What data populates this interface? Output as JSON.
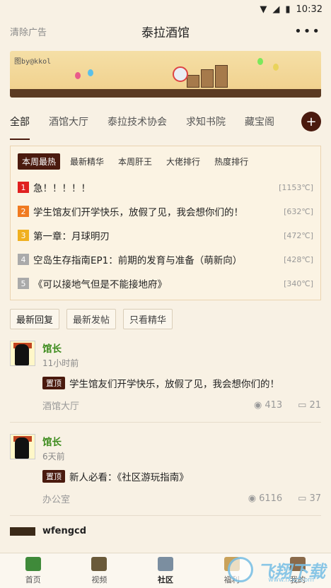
{
  "status": {
    "time": "10:32"
  },
  "topbar": {
    "left": "清除广告",
    "title": "泰拉酒馆",
    "more": "•••"
  },
  "banner": {
    "label": "图by@kkol"
  },
  "tabs": [
    "全部",
    "酒馆大厅",
    "泰拉技术协会",
    "求知书院",
    "藏宝阁"
  ],
  "hot": {
    "filters": [
      "本周最热",
      "最新精华",
      "本周肝王",
      "大佬排行",
      "热度排行"
    ],
    "items": [
      {
        "rank": "1",
        "title": "急！！！！！",
        "heat": "[1153℃]",
        "color": "#e02020"
      },
      {
        "rank": "2",
        "title": "学生馆友们开学快乐，放假了见，我会想你们的！",
        "heat": "[632℃]",
        "color": "#f07a20"
      },
      {
        "rank": "3",
        "title": "第一章：月球明刃",
        "heat": "[472℃]",
        "color": "#f0b020"
      },
      {
        "rank": "4",
        "title": "空岛生存指南EP1：前期的发育与准备（萌新向）",
        "heat": "[428℃]",
        "color": "#aaaaaa"
      },
      {
        "rank": "5",
        "title": "《可以接地气但是不能接地府》",
        "heat": "[340℃]",
        "color": "#aaaaaa"
      }
    ]
  },
  "sort": [
    "最新回复",
    "最新发帖",
    "只看精华"
  ],
  "posts": [
    {
      "author": "馆长",
      "time": "11小时前",
      "pin": "置顶",
      "text": "学生馆友们开学快乐，放假了见，我会想你们的！",
      "board": "酒馆大厅",
      "views": "413",
      "comments": "21"
    },
    {
      "author": "馆长",
      "time": "6天前",
      "pin": "置顶",
      "text": "新人必看：《社区游玩指南》",
      "board": "办公室",
      "views": "6116",
      "comments": "37"
    }
  ],
  "peek": {
    "author": "wfengcd"
  },
  "nav": [
    "首页",
    "视频",
    "社区",
    "福利",
    "我的"
  ],
  "watermark": {
    "text": "飞翔下载",
    "url": "www.fxxz.com"
  }
}
